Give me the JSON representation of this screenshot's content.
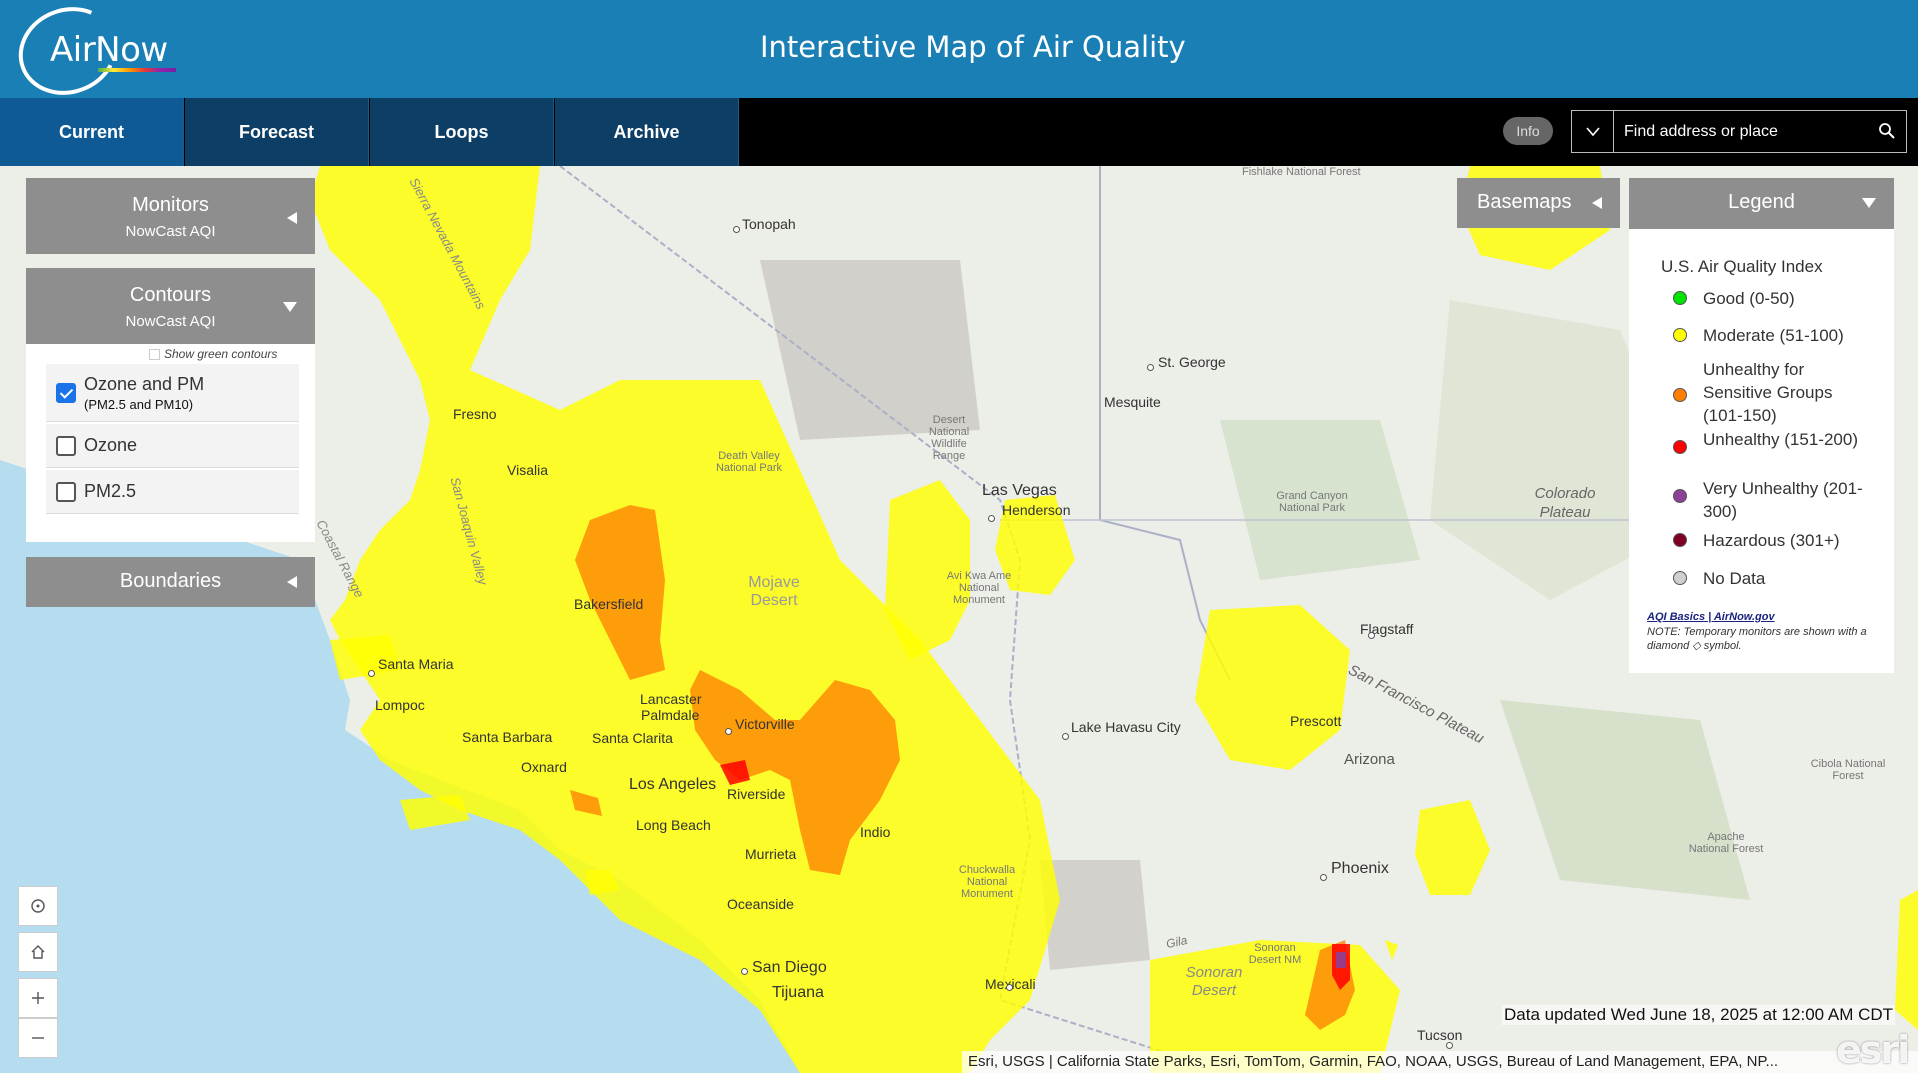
{
  "header": {
    "logo_text": "AirNow",
    "title": "Interactive Map of Air Quality"
  },
  "nav": {
    "tabs": [
      "Current",
      "Forecast",
      "Loops",
      "Archive"
    ],
    "active": "Current",
    "info_label": "Info",
    "search_placeholder": "Find address or place"
  },
  "panels": {
    "monitors": {
      "title": "Monitors",
      "subtitle": "NowCast AQI"
    },
    "contours": {
      "title": "Contours",
      "subtitle": "NowCast AQI",
      "show_green_label": "Show green contours",
      "layers": [
        {
          "label": "Ozone and PM",
          "sub": "(PM2.5 and PM10)",
          "checked": true
        },
        {
          "label": "Ozone",
          "sub": "",
          "checked": false
        },
        {
          "label": "PM2.5",
          "sub": "",
          "checked": false
        }
      ]
    },
    "boundaries": {
      "title": "Boundaries"
    },
    "basemaps": {
      "title": "Basemaps"
    },
    "legend": {
      "title": "Legend",
      "index_title": "U.S. Air Quality Index",
      "items": [
        {
          "label": "Good (0-50)",
          "color": "#00e400"
        },
        {
          "label": "Moderate (51-100)",
          "color": "#ffff00"
        },
        {
          "label": "Unhealthy for Sensitive Groups (101-150)",
          "color": "#ff7e00"
        },
        {
          "label": "Unhealthy (151-200)",
          "color": "#ff0000"
        },
        {
          "label": "Very Unhealthy (201-300)",
          "color": "#8f3f97"
        },
        {
          "label": "Hazardous (301+)",
          "color": "#7e0023"
        },
        {
          "label": "No Data",
          "color": "#d0d0d0"
        }
      ],
      "link": "AQI Basics | AirNow.gov",
      "note": "NOTE: Temporary monitors are shown with a diamond ◇ symbol."
    }
  },
  "map": {
    "places": [
      "Tonopah",
      "St. George",
      "Mesquite",
      "Las Vegas",
      "Henderson",
      "Fresno",
      "Visalia",
      "Bakersfield",
      "Santa Maria",
      "Lompoc",
      "Santa Barbara",
      "Santa Clarita",
      "Lancaster",
      "Palmdale",
      "Victorville",
      "Oxnard",
      "Los Angeles",
      "Riverside",
      "Long Beach",
      "Indio",
      "Murrieta",
      "Oceanside",
      "San Diego",
      "Tijuana",
      "Mexicali",
      "Lake Havasu City",
      "Flagstaff",
      "Prescott",
      "Arizona",
      "Phoenix",
      "Tucson"
    ],
    "regions": [
      "Fishlake National Forest",
      "Desert National Wildlife Range",
      "Death Valley National Park",
      "Mojave Desert",
      "Avi Kwa Ame National Monument",
      "Grand Canyon National Park",
      "Colorado Plateau",
      "San Francisco Plateau",
      "Cibola National Forest",
      "Apache National Forest",
      "Chuckwalla National Monument",
      "Sonoran Desert NM",
      "Sonoran Desert",
      "Sierra Nevada Mountains",
      "San Joaquin Valley",
      "Coastal Range",
      "Gila"
    ],
    "data_updated": "Data updated Wed June 18, 2025 at 12:00 AM CDT",
    "attribution": "Esri, USGS | California State Parks, Esri, TomTom, Garmin, FAO, NOAA, USGS, Bureau of Land Management, EPA, NP...",
    "esri_logo": "esri",
    "aqi_colors": {
      "moderate": "#ffff00",
      "usg": "#ff7e00",
      "unhealthy": "#ff0000",
      "very_unhealthy": "#8f3f97"
    }
  }
}
